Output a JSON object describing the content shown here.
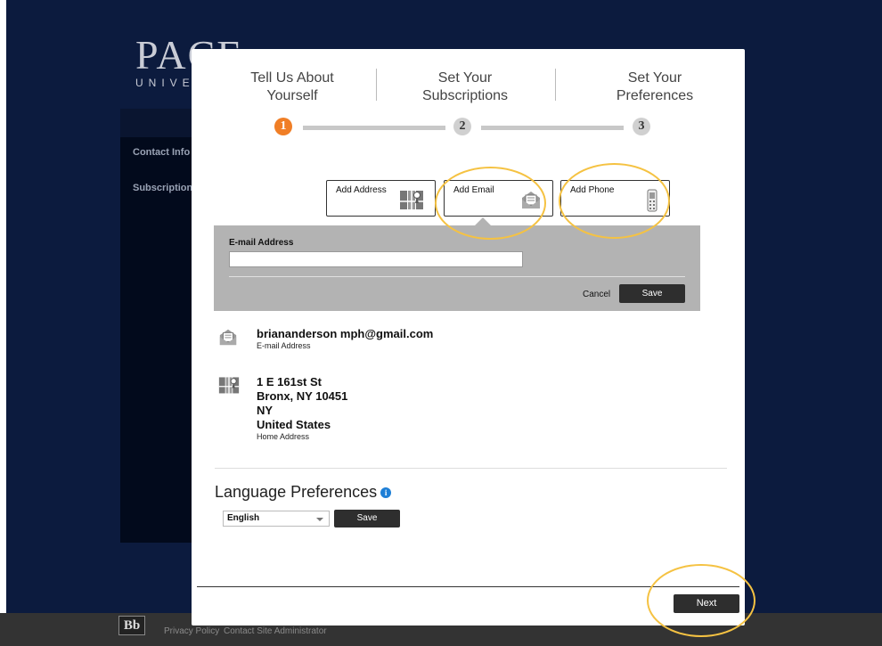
{
  "background": {
    "logo_big": "PACE",
    "logo_small": "UNIVE",
    "sidebar_items": [
      "Contact Info",
      "Subscriptions"
    ],
    "footer": {
      "bb_logo": "Bb",
      "links": [
        "Privacy Policy",
        "Contact Site Administrator"
      ]
    }
  },
  "steps": [
    {
      "line1": "Tell Us About",
      "line2": "Yourself",
      "number": "1",
      "active": true
    },
    {
      "line1": "Set Your",
      "line2": "Subscriptions",
      "number": "2",
      "active": false
    },
    {
      "line1": "Set Your",
      "line2": "Preferences",
      "number": "3",
      "active": false
    }
  ],
  "add_buttons": {
    "address": "Add Address",
    "email": "Add Email",
    "phone": "Add Phone"
  },
  "email_form": {
    "label": "E-mail Address",
    "value": "",
    "cancel": "Cancel",
    "save": "Save"
  },
  "contact_items": {
    "email": {
      "value": "briananderson mph@gmail.com",
      "type": "E-mail Address"
    },
    "address": {
      "line1": "1 E 161st St",
      "line2": "Bronx, NY 10451",
      "line3": "NY",
      "line4": "United States",
      "type": "Home Address"
    }
  },
  "language": {
    "title": "Language Preferences",
    "info_glyph": "i",
    "selected": "English",
    "save": "Save"
  },
  "next_button": "Next",
  "colors": {
    "accent_orange": "#f07e26",
    "annotation_circle": "#f5c242",
    "dark_button": "#2e2e2e",
    "navy_background": "#0c1b3e"
  }
}
